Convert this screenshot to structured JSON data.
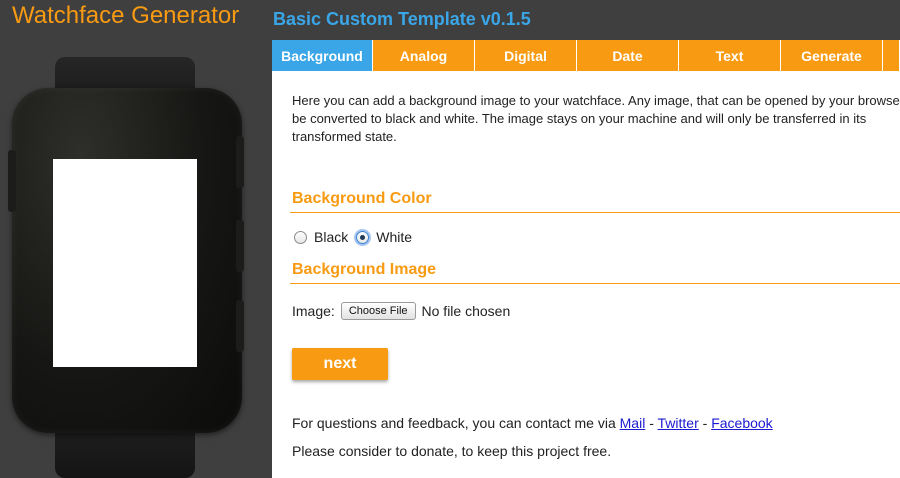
{
  "header": {
    "app_title": "Watchface Generator",
    "template_title": "Basic Custom Template v0.1.5"
  },
  "tabs": [
    {
      "label": "Background",
      "active": true
    },
    {
      "label": "Analog",
      "active": false
    },
    {
      "label": "Digital",
      "active": false
    },
    {
      "label": "Date",
      "active": false
    },
    {
      "label": "Text",
      "active": false
    },
    {
      "label": "Generate",
      "active": false
    }
  ],
  "intro_text": "Here you can add a background image to your watchface. Any image, that can be opened by your browser will be converted to black and white. The image stays on your machine and will only be transferred in its transformed state.",
  "background_color": {
    "title": "Background Color",
    "options": [
      {
        "label": "Black",
        "checked": false
      },
      {
        "label": "White",
        "checked": true
      }
    ]
  },
  "background_image": {
    "title": "Background Image",
    "field_label": "Image:",
    "button_label": "Choose File",
    "status": "No file chosen"
  },
  "next_label": "next",
  "footer": {
    "contact_prefix": "For questions and feedback, you can contact me via",
    "links": [
      "Mail",
      "Twitter",
      "Facebook"
    ],
    "separator": " - ",
    "donate_text": "Please consider to donate, to keep this project free."
  },
  "colors": {
    "accent": "#f89a12",
    "active_tab": "#3aa6e8",
    "sidebar_bg": "#3f3f3f"
  }
}
